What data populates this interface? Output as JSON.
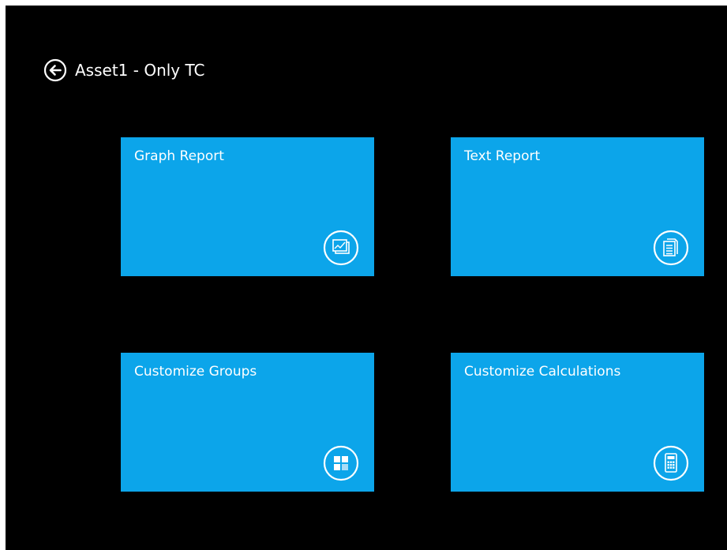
{
  "header": {
    "back_icon": "arrow-left-circle-icon",
    "title": "Asset1 - Only TC"
  },
  "tiles": [
    {
      "label": "Graph Report",
      "icon": "graph-report-icon"
    },
    {
      "label": "Text Report",
      "icon": "text-report-icon"
    },
    {
      "label": "Customize Groups",
      "icon": "groups-grid-icon"
    },
    {
      "label": "Customize Calculations",
      "icon": "calculator-icon"
    }
  ],
  "colors": {
    "background": "#000000",
    "tile": "#0ca5ea",
    "text": "#ffffff"
  }
}
